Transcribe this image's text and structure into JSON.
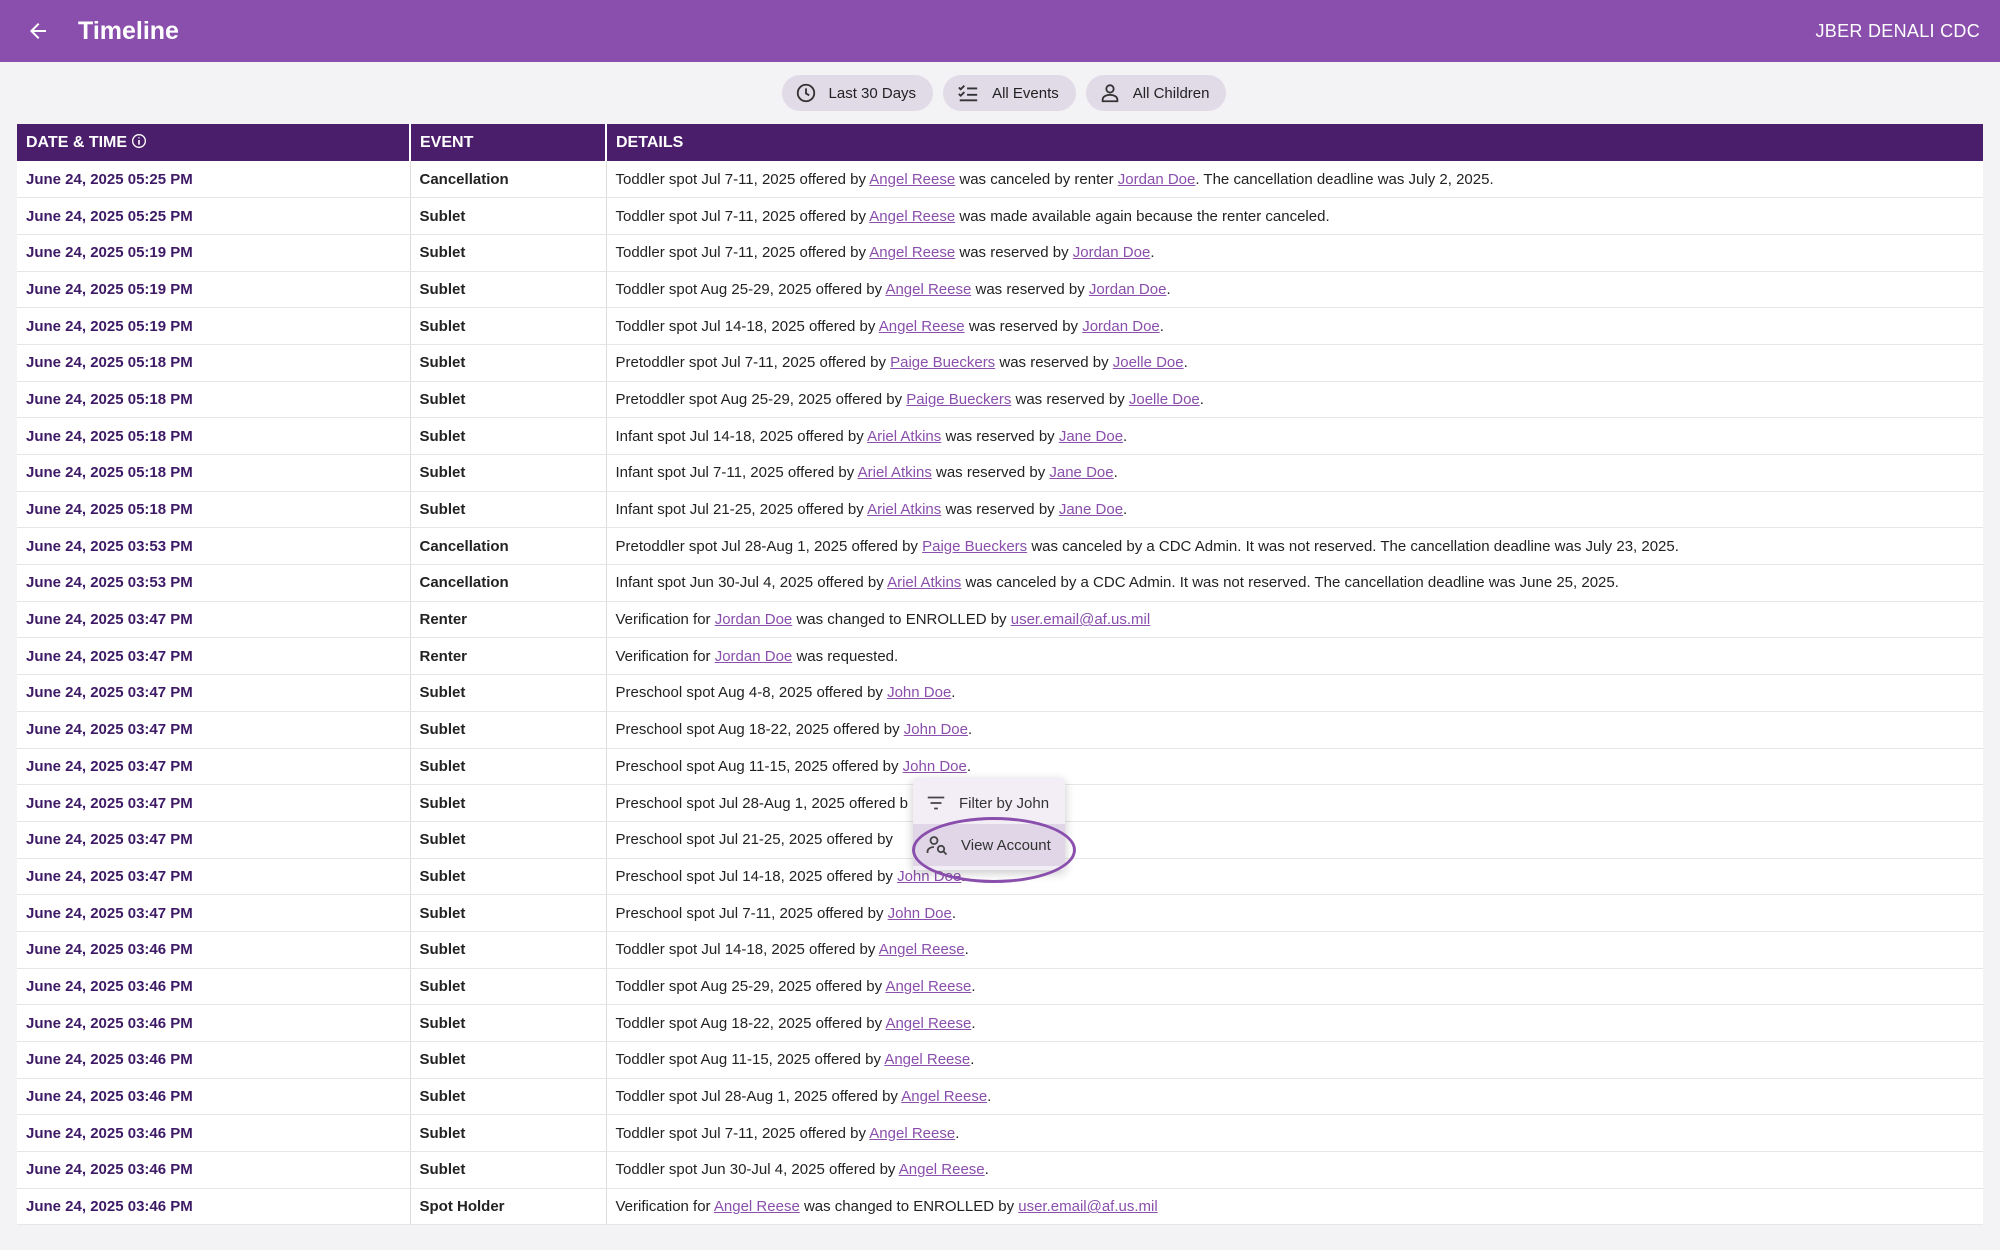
{
  "header": {
    "title": "Timeline",
    "org": "JBER DENALI CDC"
  },
  "filters": [
    {
      "label": "Last 30 Days",
      "icon": "clock-icon"
    },
    {
      "label": "All Events",
      "icon": "checklist-icon"
    },
    {
      "label": "All Children",
      "icon": "person-icon"
    }
  ],
  "table": {
    "headers": {
      "datetime": "DATE & TIME",
      "event": "EVENT",
      "details": "DETAILS"
    },
    "rows": [
      {
        "dt": "June 24, 2025 05:25 PM",
        "ev": "Cancellation",
        "details": [
          [
            "Toddler spot Jul 7-11, 2025 offered by ",
            0
          ],
          [
            "Angel Reese",
            1
          ],
          [
            " was canceled by renter ",
            0
          ],
          [
            "Jordan Doe",
            1
          ],
          [
            ". The cancellation deadline was July 2, 2025.",
            0
          ]
        ]
      },
      {
        "dt": "June 24, 2025 05:25 PM",
        "ev": "Sublet",
        "details": [
          [
            "Toddler spot Jul 7-11, 2025 offered by ",
            0
          ],
          [
            "Angel Reese",
            1
          ],
          [
            " was made available again because the renter canceled.",
            0
          ]
        ]
      },
      {
        "dt": "June 24, 2025 05:19 PM",
        "ev": "Sublet",
        "details": [
          [
            "Toddler spot Jul 7-11, 2025 offered by ",
            0
          ],
          [
            "Angel Reese",
            1
          ],
          [
            " was reserved by ",
            0
          ],
          [
            "Jordan Doe",
            1
          ],
          [
            ".",
            0
          ]
        ]
      },
      {
        "dt": "June 24, 2025 05:19 PM",
        "ev": "Sublet",
        "details": [
          [
            "Toddler spot Aug 25-29, 2025 offered by ",
            0
          ],
          [
            "Angel Reese",
            1
          ],
          [
            " was reserved by ",
            0
          ],
          [
            "Jordan Doe",
            1
          ],
          [
            ".",
            0
          ]
        ]
      },
      {
        "dt": "June 24, 2025 05:19 PM",
        "ev": "Sublet",
        "details": [
          [
            "Toddler spot Jul 14-18, 2025 offered by ",
            0
          ],
          [
            "Angel Reese",
            1
          ],
          [
            " was reserved by ",
            0
          ],
          [
            "Jordan Doe",
            1
          ],
          [
            ".",
            0
          ]
        ]
      },
      {
        "dt": "June 24, 2025 05:18 PM",
        "ev": "Sublet",
        "details": [
          [
            "Pretoddler spot Jul 7-11, 2025 offered by ",
            0
          ],
          [
            "Paige Bueckers",
            1
          ],
          [
            " was reserved by ",
            0
          ],
          [
            "Joelle Doe",
            1
          ],
          [
            ".",
            0
          ]
        ]
      },
      {
        "dt": "June 24, 2025 05:18 PM",
        "ev": "Sublet",
        "details": [
          [
            "Pretoddler spot Aug 25-29, 2025 offered by ",
            0
          ],
          [
            "Paige Bueckers",
            1
          ],
          [
            " was reserved by ",
            0
          ],
          [
            "Joelle Doe",
            1
          ],
          [
            ".",
            0
          ]
        ]
      },
      {
        "dt": "June 24, 2025 05:18 PM",
        "ev": "Sublet",
        "details": [
          [
            "Infant spot Jul 14-18, 2025 offered by ",
            0
          ],
          [
            "Ariel Atkins",
            1
          ],
          [
            " was reserved by ",
            0
          ],
          [
            "Jane Doe",
            1
          ],
          [
            ".",
            0
          ]
        ]
      },
      {
        "dt": "June 24, 2025 05:18 PM",
        "ev": "Sublet",
        "details": [
          [
            "Infant spot Jul 7-11, 2025 offered by ",
            0
          ],
          [
            "Ariel Atkins",
            1
          ],
          [
            " was reserved by ",
            0
          ],
          [
            "Jane Doe",
            1
          ],
          [
            ".",
            0
          ]
        ]
      },
      {
        "dt": "June 24, 2025 05:18 PM",
        "ev": "Sublet",
        "details": [
          [
            "Infant spot Jul 21-25, 2025 offered by ",
            0
          ],
          [
            "Ariel Atkins",
            1
          ],
          [
            " was reserved by ",
            0
          ],
          [
            "Jane Doe",
            1
          ],
          [
            ".",
            0
          ]
        ]
      },
      {
        "dt": "June 24, 2025 03:53 PM",
        "ev": "Cancellation",
        "details": [
          [
            "Pretoddler spot Jul 28-Aug 1, 2025 offered by ",
            0
          ],
          [
            "Paige Bueckers",
            1
          ],
          [
            " was canceled by a CDC Admin. It was not reserved.  The cancellation deadline was July 23, 2025.",
            0
          ]
        ]
      },
      {
        "dt": "June 24, 2025 03:53 PM",
        "ev": "Cancellation",
        "details": [
          [
            "Infant spot Jun 30-Jul 4, 2025 offered by ",
            0
          ],
          [
            "Ariel Atkins",
            1
          ],
          [
            " was canceled by a CDC Admin. It was not reserved.  The cancellation deadline was June 25, 2025.",
            0
          ]
        ]
      },
      {
        "dt": "June 24, 2025 03:47 PM",
        "ev": "Renter",
        "details": [
          [
            "Verification for ",
            0
          ],
          [
            "Jordan Doe",
            1
          ],
          [
            " was changed to ENROLLED by  ",
            0
          ],
          [
            "user.email@af.us.mil",
            1
          ]
        ]
      },
      {
        "dt": "June 24, 2025 03:47 PM",
        "ev": "Renter",
        "details": [
          [
            "Verification for ",
            0
          ],
          [
            "Jordan Doe",
            1
          ],
          [
            " was requested.",
            0
          ]
        ]
      },
      {
        "dt": "June 24, 2025 03:47 PM",
        "ev": "Sublet",
        "details": [
          [
            "Preschool spot Aug 4-8, 2025 offered by ",
            0
          ],
          [
            "John Doe",
            1
          ],
          [
            ".",
            0
          ]
        ]
      },
      {
        "dt": "June 24, 2025 03:47 PM",
        "ev": "Sublet",
        "details": [
          [
            "Preschool spot Aug 18-22, 2025 offered by ",
            0
          ],
          [
            "John Doe",
            1
          ],
          [
            ".",
            0
          ]
        ]
      },
      {
        "dt": "June 24, 2025 03:47 PM",
        "ev": "Sublet",
        "details": [
          [
            "Preschool spot Aug 11-15, 2025 offered by ",
            0
          ],
          [
            "John Doe",
            1
          ],
          [
            ".",
            0
          ]
        ]
      },
      {
        "dt": "June 24, 2025 03:47 PM",
        "ev": "Sublet",
        "details": [
          [
            "Preschool spot Jul 28-Aug 1, 2025 offered b",
            0
          ]
        ]
      },
      {
        "dt": "June 24, 2025 03:47 PM",
        "ev": "Sublet",
        "details": [
          [
            "Preschool spot Jul 21-25, 2025 offered by ",
            0
          ]
        ]
      },
      {
        "dt": "June 24, 2025 03:47 PM",
        "ev": "Sublet",
        "details": [
          [
            "Preschool spot Jul 14-18, 2025 offered by ",
            0
          ],
          [
            "John Doe",
            1
          ],
          [
            ".",
            0
          ]
        ]
      },
      {
        "dt": "June 24, 2025 03:47 PM",
        "ev": "Sublet",
        "details": [
          [
            "Preschool spot Jul 7-11, 2025 offered by ",
            0
          ],
          [
            "John Doe",
            1
          ],
          [
            ".",
            0
          ]
        ]
      },
      {
        "dt": "June 24, 2025 03:46 PM",
        "ev": "Sublet",
        "details": [
          [
            "Toddler spot Jul 14-18, 2025 offered by ",
            0
          ],
          [
            "Angel Reese",
            1
          ],
          [
            ".",
            0
          ]
        ]
      },
      {
        "dt": "June 24, 2025 03:46 PM",
        "ev": "Sublet",
        "details": [
          [
            "Toddler spot Aug 25-29, 2025 offered by ",
            0
          ],
          [
            "Angel Reese",
            1
          ],
          [
            ".",
            0
          ]
        ]
      },
      {
        "dt": "June 24, 2025 03:46 PM",
        "ev": "Sublet",
        "details": [
          [
            "Toddler spot Aug 18-22, 2025 offered by ",
            0
          ],
          [
            "Angel Reese",
            1
          ],
          [
            ".",
            0
          ]
        ]
      },
      {
        "dt": "June 24, 2025 03:46 PM",
        "ev": "Sublet",
        "details": [
          [
            "Toddler spot Aug 11-15, 2025 offered by ",
            0
          ],
          [
            "Angel Reese",
            1
          ],
          [
            ".",
            0
          ]
        ]
      },
      {
        "dt": "June 24, 2025 03:46 PM",
        "ev": "Sublet",
        "details": [
          [
            "Toddler spot Jul 28-Aug 1, 2025 offered by ",
            0
          ],
          [
            "Angel Reese",
            1
          ],
          [
            ".",
            0
          ]
        ]
      },
      {
        "dt": "June 24, 2025 03:46 PM",
        "ev": "Sublet",
        "details": [
          [
            "Toddler spot Jul 7-11, 2025 offered by ",
            0
          ],
          [
            "Angel Reese",
            1
          ],
          [
            ".",
            0
          ]
        ]
      },
      {
        "dt": "June 24, 2025 03:46 PM",
        "ev": "Sublet",
        "details": [
          [
            "Toddler spot Jun 30-Jul 4, 2025 offered by ",
            0
          ],
          [
            "Angel Reese",
            1
          ],
          [
            ".",
            0
          ]
        ]
      },
      {
        "dt": "June 24, 2025 03:46 PM",
        "ev": "Spot Holder",
        "details": [
          [
            "Verification for ",
            0
          ],
          [
            "Angel Reese",
            1
          ],
          [
            " was changed to ENROLLED by  ",
            0
          ],
          [
            "user.email@af.us.mil",
            1
          ]
        ]
      }
    ]
  },
  "context_menu": {
    "items": [
      {
        "label": "Filter by John",
        "icon": "filter-icon"
      },
      {
        "label": "View Account",
        "icon": "account-search-icon"
      }
    ]
  },
  "colors": {
    "header": "#8a4fac",
    "table_header": "#4a1e6b",
    "link": "#8a4fac",
    "datetime": "#3e1a66"
  }
}
